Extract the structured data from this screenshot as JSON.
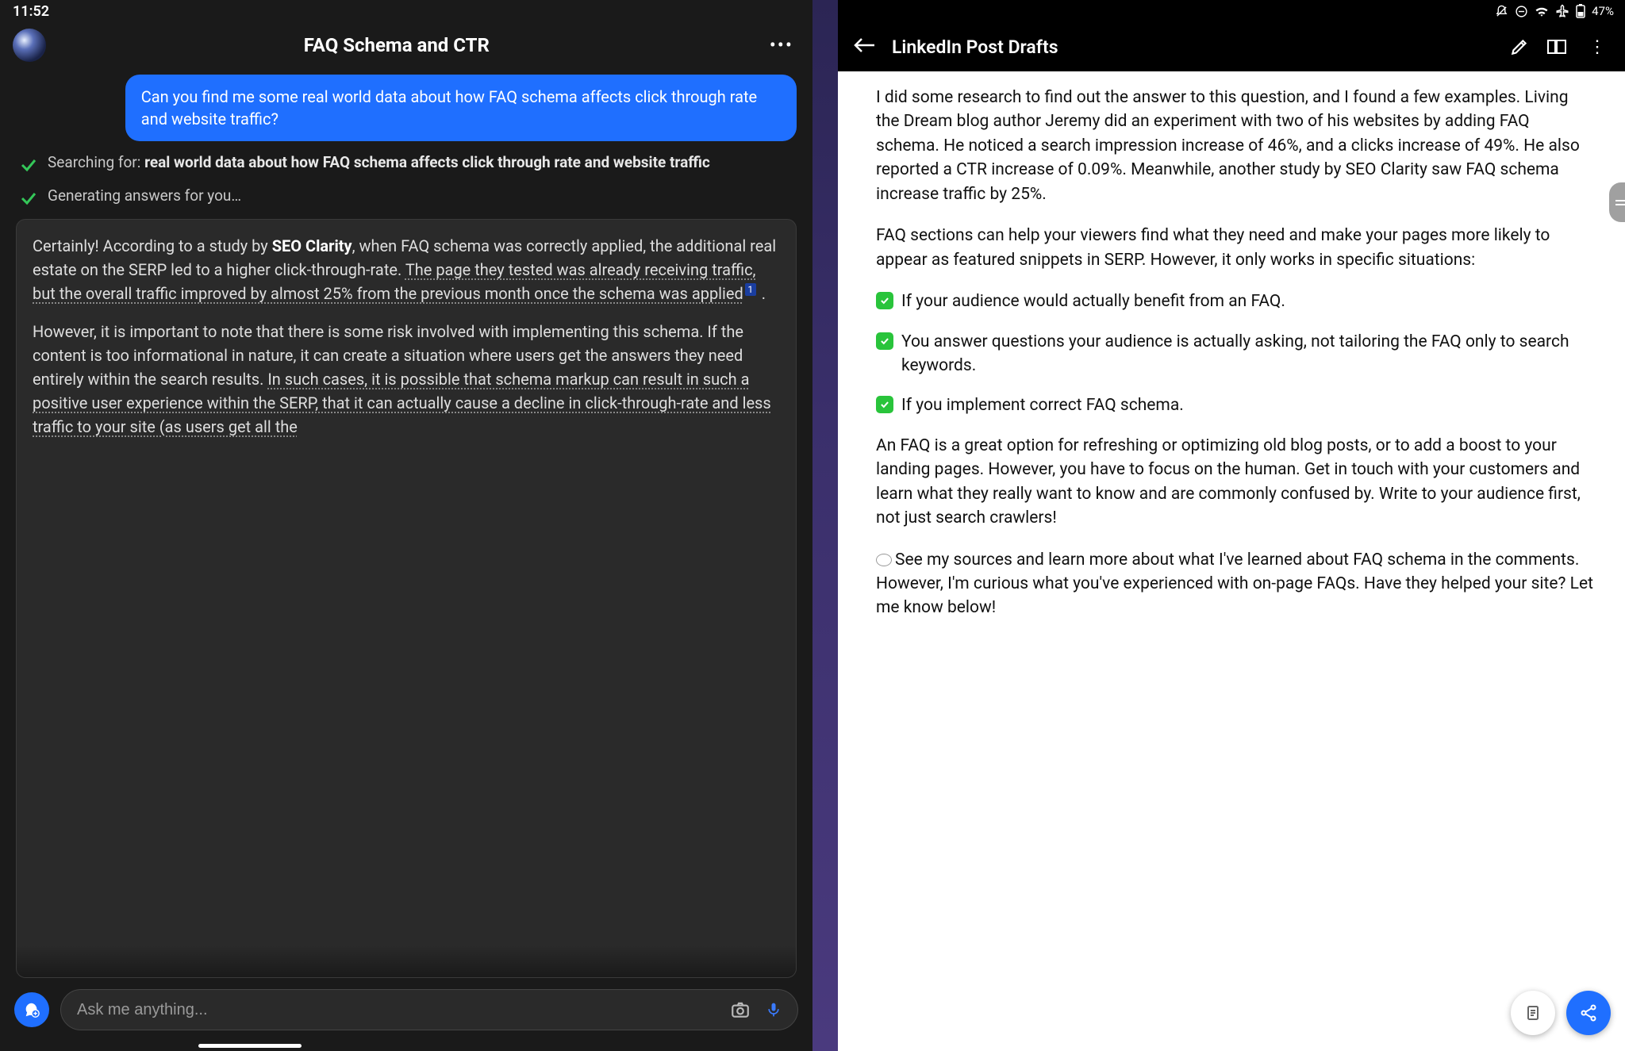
{
  "status_bar": {
    "time": "11:52",
    "battery": "47%"
  },
  "chat": {
    "title": "FAQ Schema and CTR",
    "user_message": "Can you find me some real world data about how FAQ schema affects click through rate and website traffic?",
    "search_prefix": "Searching for: ",
    "search_query": "real world data about how FAQ schema affects click through rate and website traffic",
    "generating": "Generating answers for you…",
    "answer_p1_a": "Certainly! According to a study by ",
    "answer_p1_b": "SEO Clarity",
    "answer_p1_c": ", when FAQ schema was correctly applied, the additional real estate on the SERP led to a higher click-through-rate. ",
    "answer_p1_u": "The page they tested was already receiving traffic, but the overall traffic improved by almost 25% from the previous month once the schema was applied",
    "citation1": "1",
    "answer_p1_d": " .",
    "answer_p2_a": "However, it is important to note that there is some risk involved with implementing this schema. If the content is too informational in nature, it can create a situation where users get the answers they need entirely within the search results. ",
    "answer_p2_u": "In such cases, it is possible that schema markup can result in such a positive user experience within the SERP, that it can actually cause a decline in click-through-rate and less traffic to your site (as users get all the",
    "input_placeholder": "Ask me anything..."
  },
  "doc": {
    "title": "LinkedIn Post Drafts",
    "p1": "I did some research to find out the answer to this question, and I found a few examples. Living the Dream blog author Jeremy did an experiment with two of his websites by adding FAQ schema. He noticed a search impression increase of 46%, and a clicks increase of 49%. He also reported a CTR increase of 0.09%. Meanwhile, another study by SEO Clarity saw FAQ schema increase traffic by 25%.",
    "p2": "FAQ sections can help your viewers find what they need and make your pages more likely to appear as featured snippets in SERP. However, it only works in specific situations:",
    "bullet1": "If your audience would actually benefit from an FAQ.",
    "bullet2": "You answer questions your audience is actually asking, not tailoring the FAQ only to search keywords.",
    "bullet3": "If you implement correct FAQ schema.",
    "p3": "An FAQ is a great option for refreshing or optimizing old blog posts, or to add a boost to your landing pages. However, you have to focus on the human. Get in touch with your customers and learn what they really want to know and are commonly confused by. Write to your audience first, not just search crawlers!",
    "p4": "See my sources and learn more about what I've learned about FAQ schema in the comments. However, I'm curious what you've experienced with on-page FAQs. Have they helped your site? Let me know below!"
  }
}
